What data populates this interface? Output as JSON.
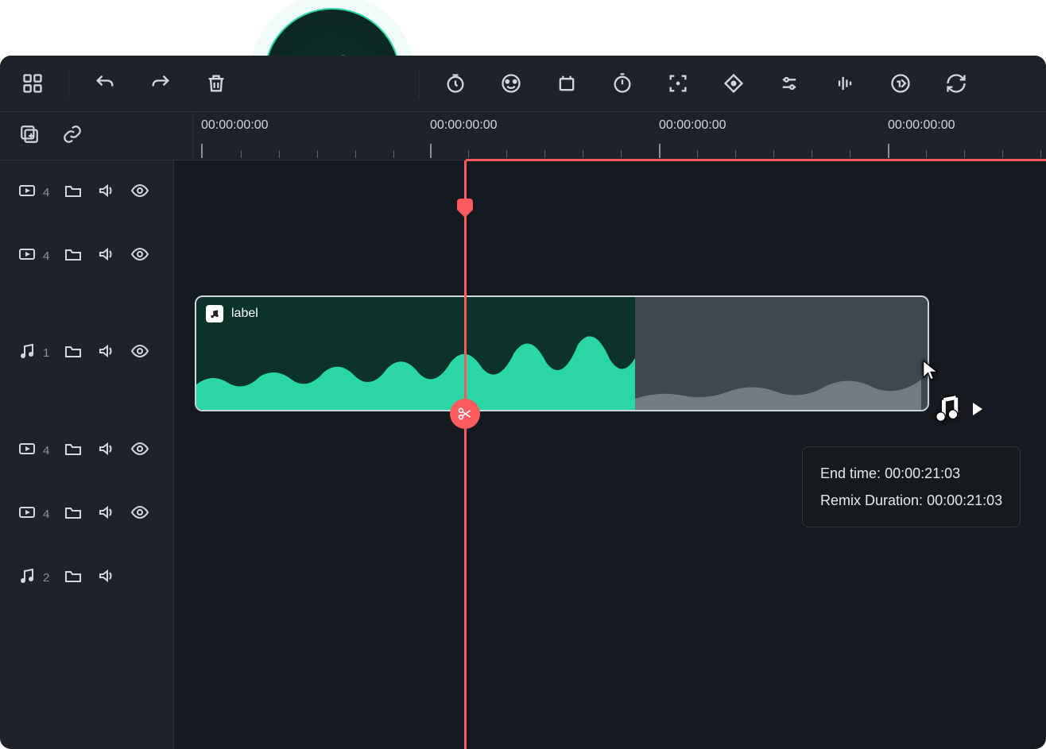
{
  "colors": {
    "accent": "#2ad7a4",
    "red": "#ff5a5f"
  },
  "ruler": {
    "times": [
      "00:00:00:00",
      "00:00:00:00",
      "00:00:00:00",
      "00:00:00:00"
    ]
  },
  "tracks": [
    {
      "type": "video",
      "num": "4",
      "folder": true,
      "volume": true,
      "eye": true
    },
    {
      "type": "video",
      "num": "4",
      "folder": true,
      "volume": true,
      "eye": true
    },
    {
      "type": "audio",
      "num": "1",
      "folder": true,
      "volume": true,
      "eye": true,
      "main": true
    },
    {
      "type": "video",
      "num": "4",
      "folder": true,
      "volume": true,
      "eye": true
    },
    {
      "type": "video",
      "num": "4",
      "folder": true,
      "volume": true,
      "eye": true
    },
    {
      "type": "audio",
      "num": "2",
      "folder": true,
      "volume": true,
      "eye": false
    }
  ],
  "clip": {
    "label": "label"
  },
  "tooltip": {
    "end_label": "End time:",
    "end_value": "00:00:21:03",
    "dur_label": "Remix Duration:",
    "dur_value": "00:00:21:03"
  }
}
